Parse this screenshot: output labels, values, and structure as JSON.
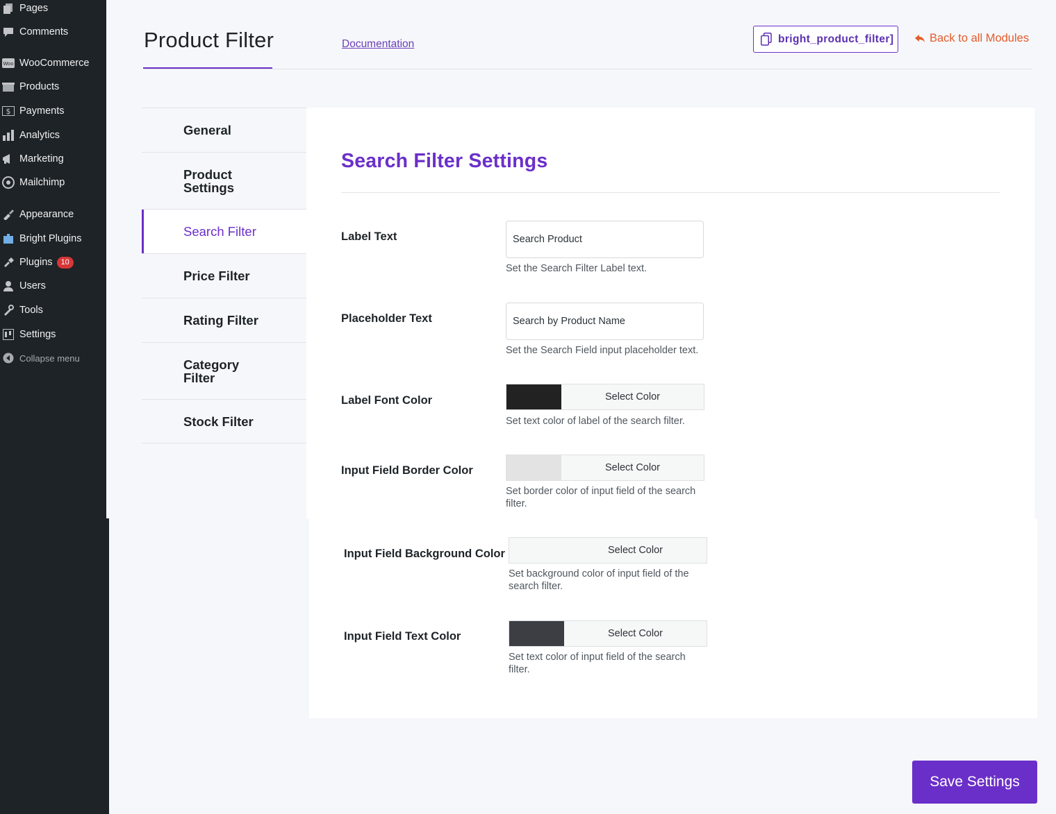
{
  "wp_menu": [
    {
      "label": "Pages",
      "icon": "pages-icon"
    },
    {
      "label": "Comments",
      "icon": "comments-icon"
    },
    {
      "label": "WooCommerce",
      "icon": "woocommerce-icon"
    },
    {
      "label": "Products",
      "icon": "products-icon"
    },
    {
      "label": "Payments",
      "icon": "payments-icon"
    },
    {
      "label": "Analytics",
      "icon": "analytics-icon"
    },
    {
      "label": "Marketing",
      "icon": "marketing-icon"
    },
    {
      "label": "Mailchimp",
      "icon": "mailchimp-icon"
    },
    {
      "label": "Appearance",
      "icon": "appearance-icon"
    },
    {
      "label": "Bright Plugins",
      "icon": "bright-plugins-icon"
    },
    {
      "label": "Plugins",
      "icon": "plugins-icon",
      "badge": "10"
    },
    {
      "label": "Users",
      "icon": "users-icon"
    },
    {
      "label": "Tools",
      "icon": "tools-icon"
    },
    {
      "label": "Settings",
      "icon": "settings-icon"
    },
    {
      "label": "Collapse menu",
      "icon": "collapse-icon"
    }
  ],
  "header": {
    "title": "Product Filter",
    "documentation_label": "Documentation",
    "shortcode": "bright_product_filter]",
    "back_label": "Back to all Modules"
  },
  "tabs": [
    {
      "label": "General"
    },
    {
      "label": "Product Settings"
    },
    {
      "label": "Search Filter",
      "active": true
    },
    {
      "label": "Price Filter"
    },
    {
      "label": "Rating Filter"
    },
    {
      "label": "Category Filter"
    },
    {
      "label": "Stock Filter"
    }
  ],
  "section": {
    "title": "Search Filter Settings",
    "fields": {
      "label_text": {
        "label": "Label Text",
        "value": "Search Product",
        "help": "Set the Search Filter Label text."
      },
      "placeholder_text": {
        "label": "Placeholder Text",
        "value": "Search by Product Name",
        "help": "Set the Search Field input placeholder text."
      },
      "label_font_color": {
        "label": "Label Font Color",
        "swatch": "#222222",
        "button": "Select Color",
        "help": "Set text color of label of the search filter."
      },
      "input_border_color": {
        "label": "Input Field Border Color",
        "swatch": "#e3e3e3",
        "button": "Select Color",
        "help": "Set border color of input field of the search filter."
      },
      "input_bg_color": {
        "label": "Input Field Background Color",
        "swatch": "",
        "button": "Select Color",
        "help": "Set background color of input field of the search filter."
      },
      "input_text_color": {
        "label": "Input Field Text Color",
        "swatch": "#3d3e44",
        "button": "Select Color",
        "help": "Set text color of input field of the search filter."
      }
    }
  },
  "save_label": "Save Settings",
  "colors": {
    "accent": "#6b2fc9",
    "back_link": "#e35c2b",
    "sidebar_bg": "#1d2327",
    "badge": "#d63638"
  }
}
